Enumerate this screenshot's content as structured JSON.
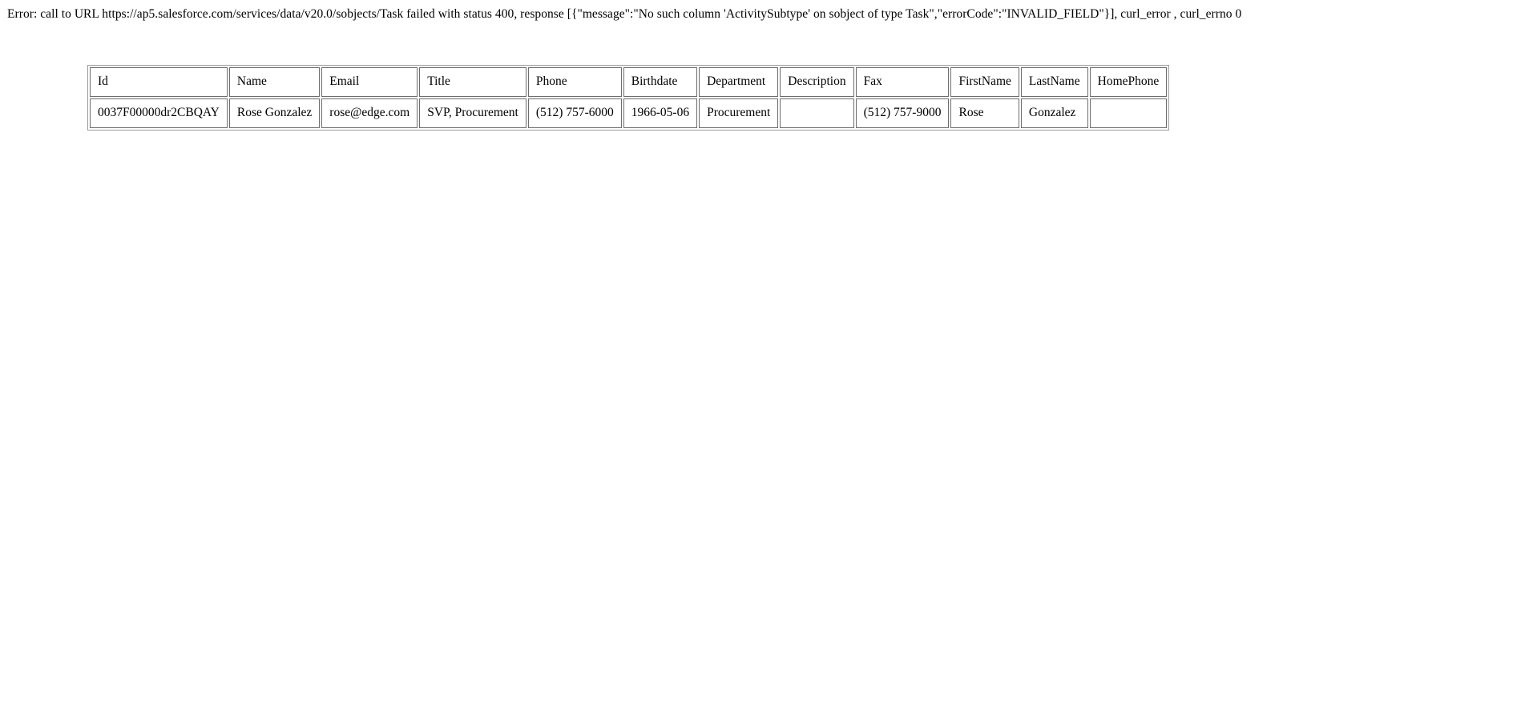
{
  "error": {
    "text": "Error: call to URL https://ap5.salesforce.com/services/data/v20.0/sobjects/Task failed with status 400, response [{\"message\":\"No such column 'ActivitySubtype' on sobject of type Task\",\"errorCode\":\"INVALID_FIELD\"}], curl_error , curl_errno 0"
  },
  "table": {
    "columns": [
      {
        "key": "id",
        "label": "Id"
      },
      {
        "key": "name",
        "label": "Name"
      },
      {
        "key": "email",
        "label": "Email"
      },
      {
        "key": "title",
        "label": "Title"
      },
      {
        "key": "phone",
        "label": "Phone"
      },
      {
        "key": "birthdate",
        "label": "Birthdate"
      },
      {
        "key": "department",
        "label": "Department"
      },
      {
        "key": "description",
        "label": "Description"
      },
      {
        "key": "fax",
        "label": "Fax"
      },
      {
        "key": "firstname",
        "label": "FirstName"
      },
      {
        "key": "lastname",
        "label": "LastName"
      },
      {
        "key": "homephone",
        "label": "HomePhone"
      }
    ],
    "rows": [
      {
        "id": "0037F00000dr2CBQAY",
        "name": "Rose Gonzalez",
        "email": "rose@edge.com",
        "title": "SVP, Procurement",
        "phone": "(512) 757-6000",
        "birthdate": "1966-05-06",
        "department": "Procurement",
        "description": "",
        "fax": "(512) 757-9000",
        "firstname": "Rose",
        "lastname": "Gonzalez",
        "homephone": ""
      }
    ]
  }
}
